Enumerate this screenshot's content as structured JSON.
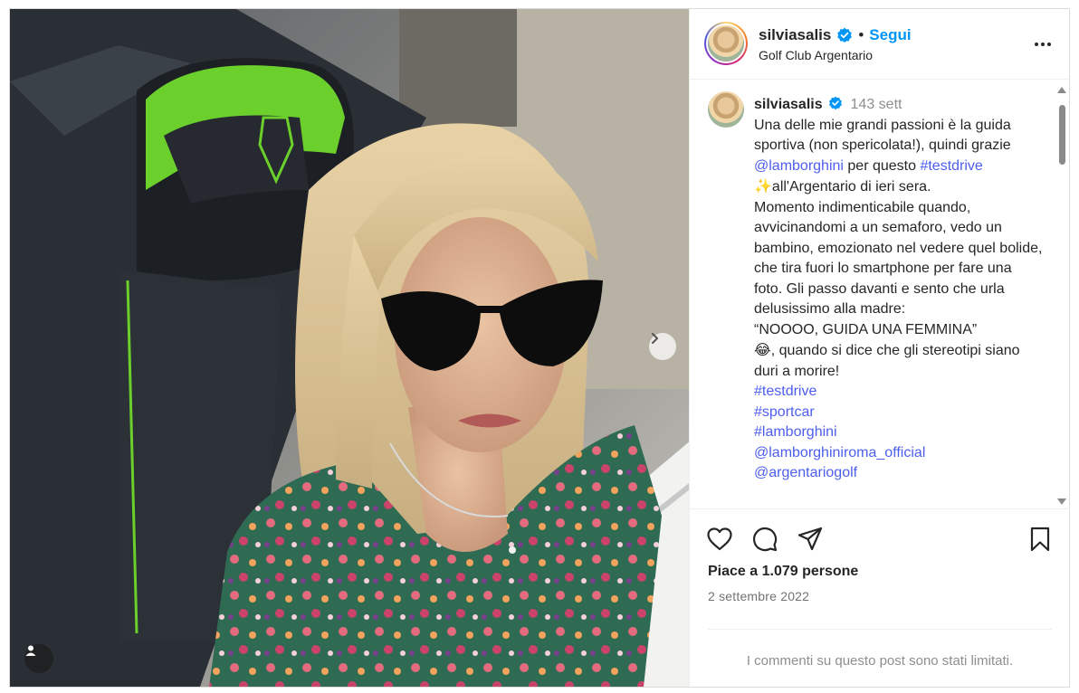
{
  "header": {
    "username": "silviasalis",
    "separator": "•",
    "follow_label": "Segui",
    "location": "Golf Club Argentario"
  },
  "caption": {
    "username": "silviasalis",
    "time": "143 sett",
    "line1": "Una delle mie grandi passioni è la guida sportiva (non spericolata!), quindi grazie ",
    "mention_lamborghini": "@lamborghini",
    "text_per_questo": " per questo ",
    "hashtag_testdrive_inline": "#testdrive",
    "emoji_sparkles": "✨",
    "line2": "all'Argentario di ieri sera.",
    "line3": "Momento indimenticabile quando, avvicinandomi a un semaforo, vedo un bambino, emozionato nel vedere quel bolide, che tira fuori lo smartphone per fare una foto. Gli passo davanti e sento che urla delusissimo alla madre:",
    "quote": "“NOOOO, GUIDA UNA FEMMINA”",
    "emoji_laugh": "😂",
    "line4": ", quando si dice che gli stereotipi siano duri a morire!",
    "tags": [
      "#testdrive",
      "#sportcar",
      "#lamborghini",
      "@lamborghiniroma_official",
      "@argentariogolf"
    ]
  },
  "actions": {
    "likes": "Piace a 1.079 persone",
    "date": "2 settembre 2022",
    "comments_limited": "I commenti su questo post sono stati limitati."
  },
  "icons": {
    "like": "heart-icon",
    "comment": "comment-icon",
    "share": "share-icon",
    "save": "bookmark-icon",
    "more": "more-options-icon",
    "next": "chevron-right-icon",
    "tags": "user-tag-icon",
    "verified": "verified-badge-icon"
  },
  "colors": {
    "accent": "#0095f6",
    "link": "#4d5eee",
    "verified": "#0095f6"
  }
}
